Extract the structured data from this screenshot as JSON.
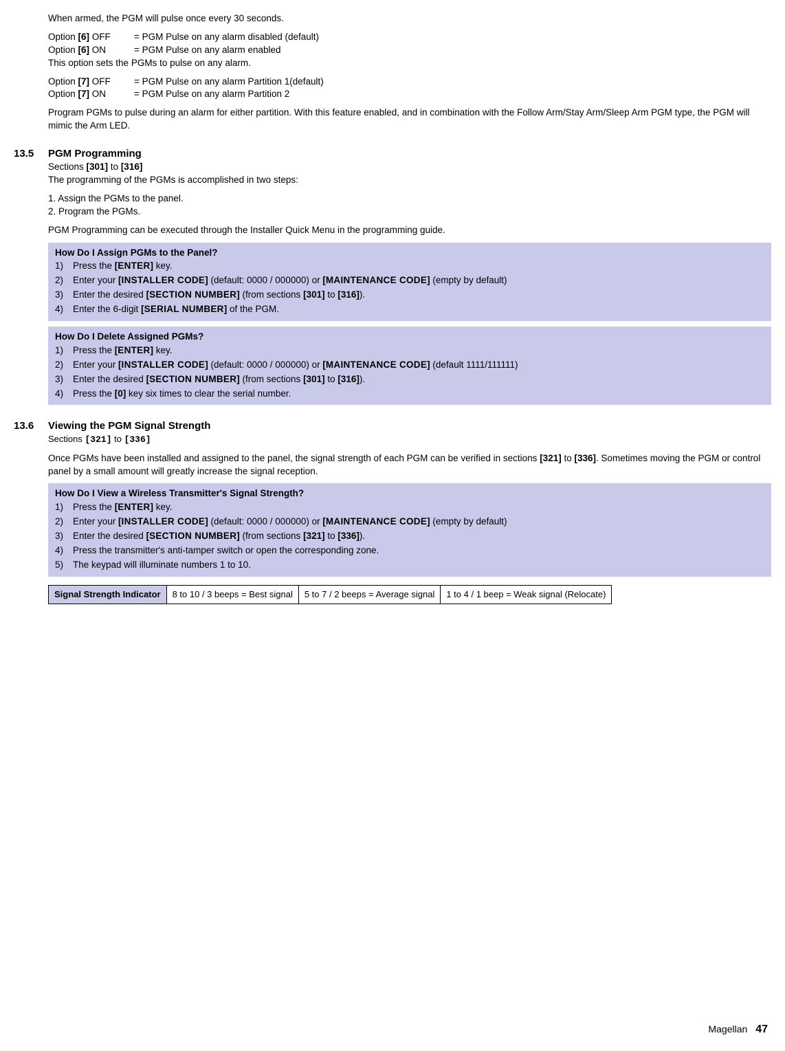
{
  "intro": {
    "pulse_note": "When armed, the PGM will pulse once every 30 seconds.",
    "opt6_off_label": "Option [6] OFF",
    "opt6_off_desc": "= PGM Pulse on any alarm disabled (default)",
    "opt6_on_label": "Option [6] ON",
    "opt6_on_desc": "= PGM Pulse on any alarm enabled",
    "opt6_note": "This option sets the PGMs to pulse on any alarm.",
    "opt7_off_label": "Option [7] OFF",
    "opt7_off_desc": "= PGM Pulse on any alarm Partition 1(default)",
    "opt7_on_label": "Option [7] ON",
    "opt7_on_desc": "= PGM Pulse on any alarm Partition 2",
    "partition_para": "Program PGMs to pulse during an alarm for either partition. With this feature enabled, and in combination with the Follow Arm/Stay Arm/Sleep Arm PGM type, the PGM will mimic the Arm LED."
  },
  "s135": {
    "num": "13.5",
    "title": "PGM Programming",
    "sections_prefix": "Sections ",
    "sections_a": "[301]",
    "sections_to": " to ",
    "sections_b": "[316]",
    "intro": "The programming of the PGMs is accomplished in two steps:",
    "step1": "1. Assign the PGMs to the panel.",
    "step2": "2. Program the PGMs.",
    "note": "PGM Programming can be executed through the Installer Quick Menu in the programming guide.",
    "box_assign": {
      "title": "How Do I Assign PGMs to the Panel?",
      "items": [
        {
          "n": "1)",
          "pre": "Press the ",
          "key": "[ENTER]",
          "post": " key."
        },
        {
          "n": "2)",
          "pre": "Enter your ",
          "key": "[INSTALLER CODE]",
          "mid": " (default: 0000 / 000000) or ",
          "key2": "[MAINTENANCE CODE]",
          "post": " (empty by default)"
        },
        {
          "n": "3)",
          "pre": "Enter the desired ",
          "key": "[SECTION NUMBER]",
          "mid": " (from sections ",
          "b1": "[301]",
          "to": " to ",
          "b2": "[316]",
          "post": ")."
        },
        {
          "n": "4)",
          "pre": "Enter the 6-digit ",
          "key": "[SERIAL NUMBER]",
          "post": " of the PGM."
        }
      ]
    },
    "box_delete": {
      "title": "How Do I Delete Assigned PGMs?",
      "items": [
        {
          "n": "1)",
          "pre": "Press the ",
          "key": "[ENTER]",
          "post": " key."
        },
        {
          "n": "2)",
          "pre": "Enter your ",
          "key": "[INSTALLER CODE]",
          "mid": " (default: 0000 / 000000) or ",
          "key2": "[MAINTENANCE CODE]",
          "post": " (default 1111/111111)"
        },
        {
          "n": "3)",
          "pre": "Enter the desired ",
          "key": "[SECTION NUMBER]",
          "mid": " (from sections ",
          "b1": "[301]",
          "to": " to ",
          "b2": "[316]",
          "post": ")."
        },
        {
          "n": "4)",
          "pre": "Press the ",
          "key": "[0]",
          "post": " key six times to clear the serial number."
        }
      ]
    }
  },
  "s136": {
    "num": "13.6",
    "title": "Viewing the PGM Signal Strength",
    "sections_prefix": "Sections ",
    "sections_a": "[321]",
    "sections_to": " to ",
    "sections_b": "[336]",
    "para_pre": "Once PGMs have been installed and assigned to the panel, the signal strength of each PGM can be verified in sections ",
    "para_a": "[321]",
    "para_to": " to ",
    "para_b": "[336]",
    "para_post": ". Sometimes moving the PGM or control panel by a small amount will greatly increase the signal reception.",
    "box_view": {
      "title": "How Do I View a Wireless Transmitter's Signal Strength?",
      "items": [
        {
          "n": "1)",
          "pre": "Press the ",
          "key": "[ENTER]",
          "post": " key."
        },
        {
          "n": "2)",
          "pre": "Enter your ",
          "key": "[INSTALLER CODE]",
          "mid": " (default: 0000 / 000000) or ",
          "key2": "[MAINTENANCE CODE]",
          "post": " (empty by default)"
        },
        {
          "n": "3)",
          "pre": "Enter the desired ",
          "key": "[SECTION NUMBER]",
          "mid": " (from sections ",
          "b1": "[321]",
          "to": " to ",
          "b2": "[336]",
          "post": ")."
        },
        {
          "n": "4)",
          "pre": "Press the transmitter's anti-tamper switch or open the corresponding zone.",
          "key": "",
          "post": ""
        },
        {
          "n": "5)",
          "pre": "The keypad will illuminate numbers 1 to 10.",
          "key": "",
          "post": ""
        }
      ]
    },
    "table": {
      "header": "Signal Strength Indicator",
      "c1": "8 to 10 / 3 beeps = Best signal",
      "c2": "5 to 7 / 2 beeps = Average signal",
      "c3": "1 to 4 / 1 beep = Weak signal (Relocate)"
    }
  },
  "footer": {
    "product": "Magellan",
    "page": "47"
  }
}
